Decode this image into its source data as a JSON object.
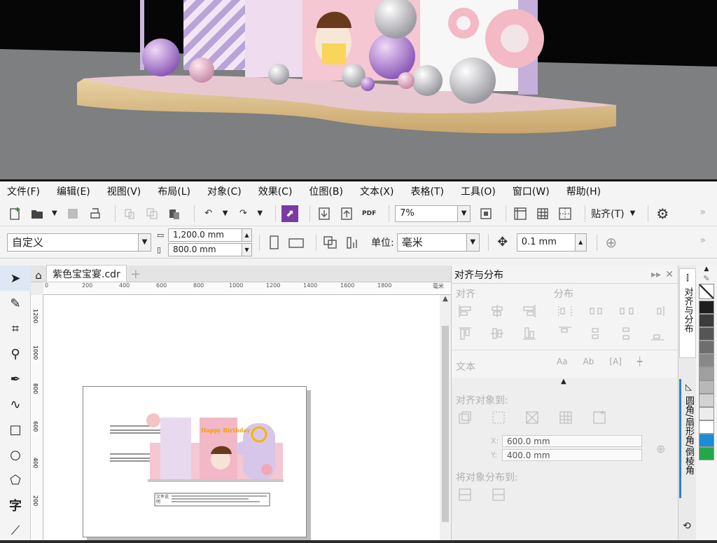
{
  "menu": [
    "文件(F)",
    "编辑(E)",
    "视图(V)",
    "布局(L)",
    "对象(C)",
    "效果(C)",
    "位图(B)",
    "文本(X)",
    "表格(T)",
    "工具(O)",
    "窗口(W)",
    "帮助(H)"
  ],
  "toolbar": {
    "zoom": "7%",
    "snap_label": "贴齐(T)"
  },
  "propbar": {
    "preset": "自定义",
    "width": "1,200.0 mm",
    "height": "800.0 mm",
    "units_label": "单位:",
    "units": "毫米",
    "nudge": "0.1 mm"
  },
  "tab": {
    "filename": "紫色宝宝宴.cdr"
  },
  "ruler": {
    "h_ticks": [
      "0",
      "200",
      "400",
      "600",
      "800",
      "1000",
      "1200",
      "1400",
      "1600",
      "1800"
    ],
    "h_unit": "毫米",
    "v_ticks": [
      "1200",
      "1000",
      "800",
      "600",
      "400",
      "200"
    ]
  },
  "artwork": {
    "title": "Happy Birthday",
    "panel_text": "文件说明"
  },
  "panel": {
    "title": "对齐与分布",
    "align_label": "对齐",
    "dist_label": "分布",
    "text_label": "文本",
    "align_to_label": "对齐对象到:",
    "x_value": "600.0 mm",
    "y_value": "400.0 mm",
    "x_label": "X:",
    "y_label": "Y:",
    "dist_to_label": "将对象分布到:"
  },
  "sidetabs": {
    "tab1": "对齐与分布",
    "tab2": "圆角/扇形角/倒棱角"
  },
  "colors": {
    "palette": [
      "#1e1e1e",
      "#3c3c3c",
      "#555555",
      "#6e6e6e",
      "#888888",
      "#a0a0a0",
      "#b8b8b8",
      "#d2d2d2",
      "#ececec",
      "#ffffff",
      "#1a8cd8",
      "#22a84a"
    ],
    "accent": "#6a3fa0"
  }
}
